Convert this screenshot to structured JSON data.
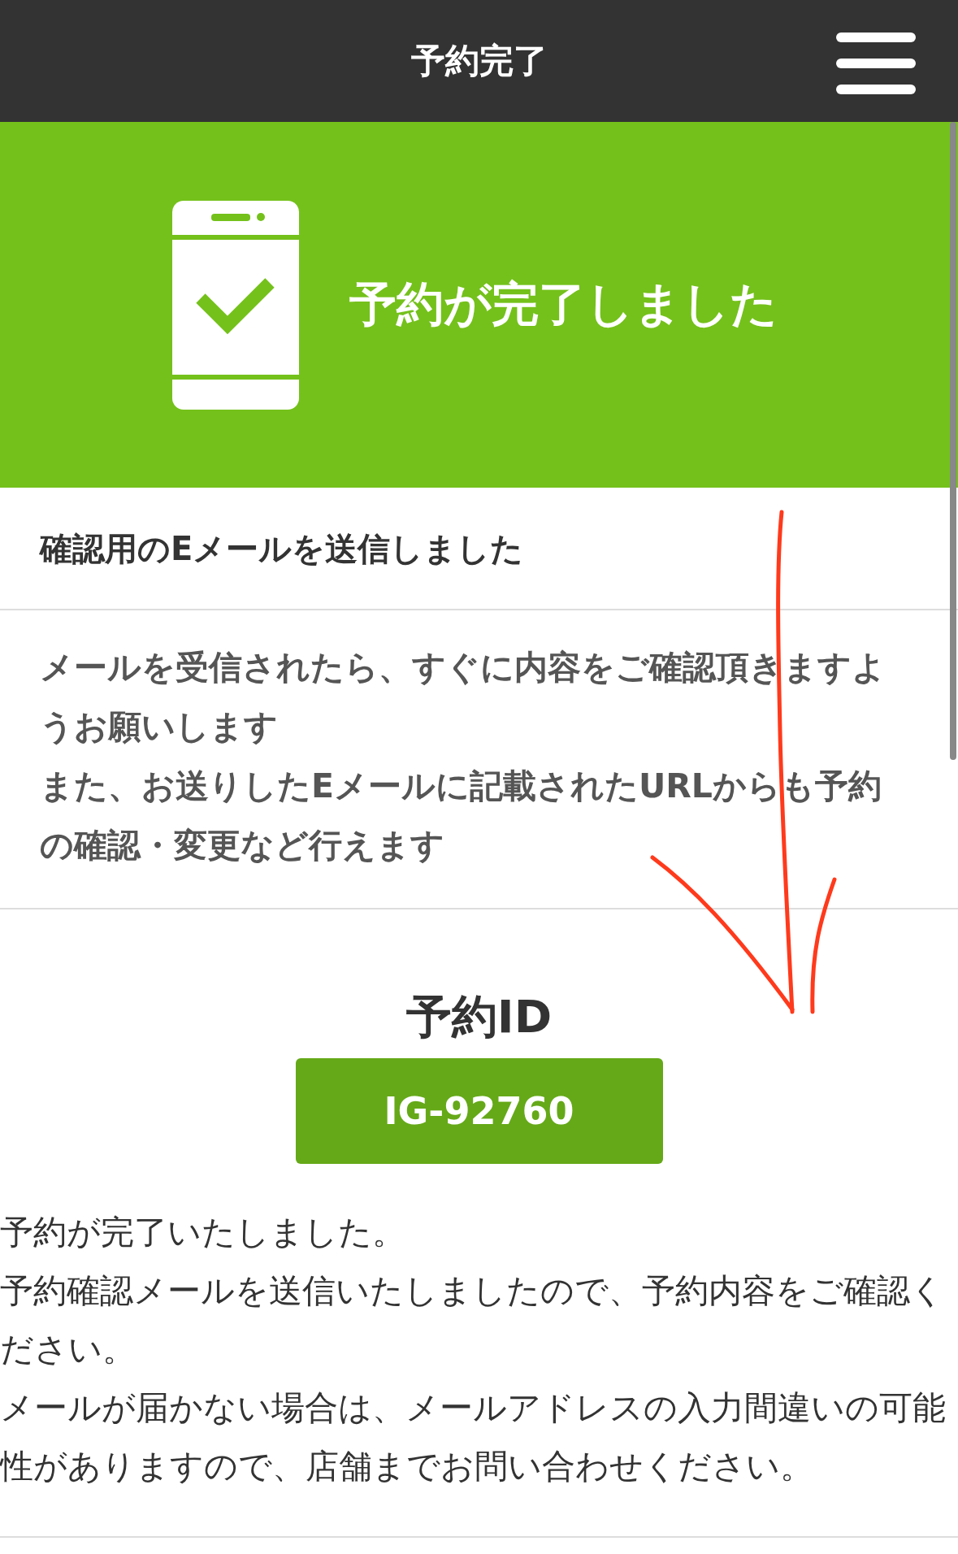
{
  "header": {
    "title": "予約完了"
  },
  "banner": {
    "title": "予約が完了しました"
  },
  "notice": {
    "heading": "確認用のEメールを送信しました",
    "lines": [
      "メールを受信されたら、すぐに内容をご確認頂きますようお願いします",
      "また、お送りしたEメールに記載されたURLからも予約の確認・変更など行えます"
    ]
  },
  "reservation": {
    "label": "予約ID",
    "id": "IG-92760"
  },
  "message": [
    "予約が完了いたしました。",
    "予約確認メールを送信いたしましたので、予約内容をご確認ください。",
    "メールが届かない場合は、メールアドレスの入力間違いの可能性がありますので、店舗までお問い合わせください。"
  ]
}
